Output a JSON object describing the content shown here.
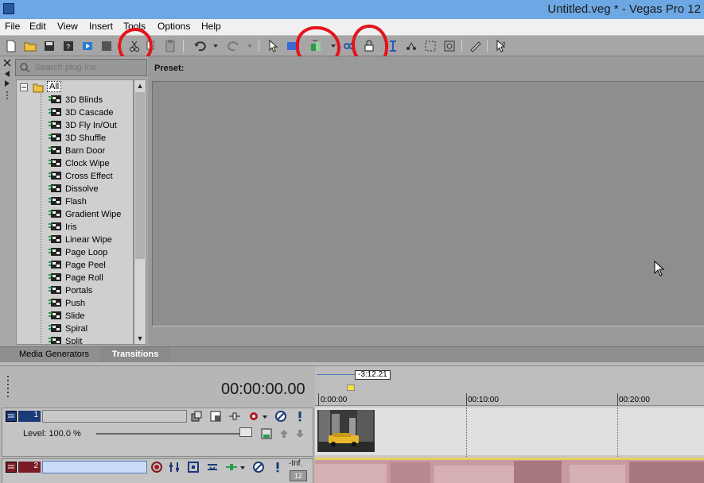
{
  "window": {
    "title": "Untitled.veg * - Vegas Pro 12"
  },
  "menu": [
    "File",
    "Edit",
    "View",
    "Insert",
    "Tools",
    "Options",
    "Help"
  ],
  "search": {
    "placeholder": "Search plug-ins"
  },
  "tree": {
    "root": "All",
    "items": [
      "3D Blinds",
      "3D Cascade",
      "3D Fly In/Out",
      "3D Shuffle",
      "Barn Door",
      "Clock Wipe",
      "Cross Effect",
      "Dissolve",
      "Flash",
      "Gradient Wipe",
      "Iris",
      "Linear Wipe",
      "Page Loop",
      "Page Peel",
      "Page Roll",
      "Portals",
      "Push",
      "Slide",
      "Spiral",
      "Split"
    ]
  },
  "preset": {
    "label": "Preset:"
  },
  "tabs": [
    {
      "label": "Media Generators",
      "active": false
    },
    {
      "label": "Transitions",
      "active": true
    }
  ],
  "timeline": {
    "timecode": "00:00:00.00",
    "loop_length": "-3:12.21",
    "ruler": [
      "0:00:00",
      "00:10:00",
      "00:20:00"
    ]
  },
  "tracks": [
    {
      "number": "1",
      "type": "video",
      "level_text": "Level: 100.0 %"
    },
    {
      "number": "2",
      "type": "audio",
      "vol_text": "-Inf.",
      "meter_text": "12"
    }
  ],
  "colors": {
    "annotation": "#e3141b",
    "titlebar": "#6ea8e4",
    "video_track": "#1a3a7a",
    "audio_track": "#7a1a24"
  }
}
